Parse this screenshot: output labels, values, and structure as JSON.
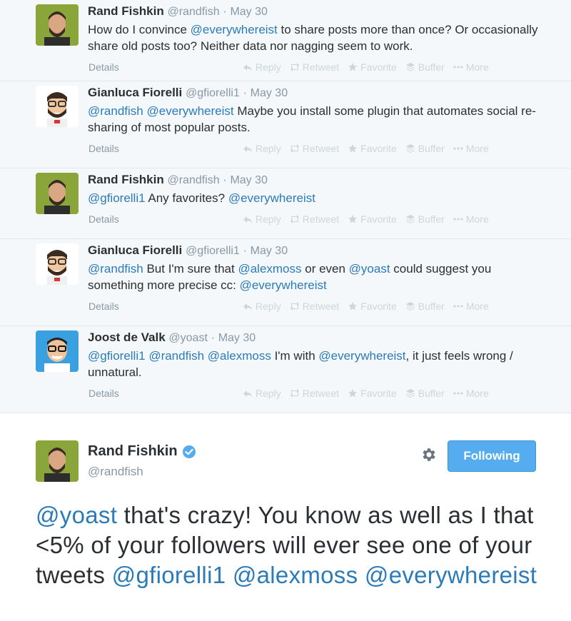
{
  "replies": [
    {
      "fullname": "Rand Fishkin",
      "screenname": "@randfish",
      "sep": "·",
      "date": "May 30",
      "avatar": "rand-avatar",
      "text_parts": [
        {
          "t": "How do I convince ",
          "m": false
        },
        {
          "t": "@everywhereist",
          "m": true
        },
        {
          "t": " to share posts more than once? Or occasionally share old posts too? Neither data nor nagging seem to work.",
          "m": false
        }
      ]
    },
    {
      "fullname": "Gianluca Fiorelli",
      "screenname": "@gfiorelli1",
      "sep": "·",
      "date": "May 30",
      "avatar": "gianluca-avatar",
      "text_parts": [
        {
          "t": "@randfish",
          "m": true
        },
        {
          "t": " ",
          "m": false
        },
        {
          "t": "@everywhereist",
          "m": true
        },
        {
          "t": " Maybe you install some plugin that automates social re-sharing of most popular posts.",
          "m": false
        }
      ]
    },
    {
      "fullname": "Rand Fishkin",
      "screenname": "@randfish",
      "sep": "·",
      "date": "May 30",
      "avatar": "rand-avatar",
      "text_parts": [
        {
          "t": "@gfiorelli1",
          "m": true
        },
        {
          "t": " Any favorites? ",
          "m": false
        },
        {
          "t": "@everywhereist",
          "m": true
        }
      ]
    },
    {
      "fullname": "Gianluca Fiorelli",
      "screenname": "@gfiorelli1",
      "sep": "·",
      "date": "May 30",
      "avatar": "gianluca-avatar",
      "text_parts": [
        {
          "t": "@randfish",
          "m": true
        },
        {
          "t": " But I'm sure that ",
          "m": false
        },
        {
          "t": "@alexmoss",
          "m": true
        },
        {
          "t": " or even ",
          "m": false
        },
        {
          "t": "@yoast",
          "m": true
        },
        {
          "t": " could suggest you something more precise cc: ",
          "m": false
        },
        {
          "t": "@everywhereist",
          "m": true
        }
      ]
    },
    {
      "fullname": "Joost de Valk",
      "screenname": "@yoast",
      "sep": "·",
      "date": "May 30",
      "avatar": "joost-avatar",
      "text_parts": [
        {
          "t": "@gfiorelli1",
          "m": true
        },
        {
          "t": " ",
          "m": false
        },
        {
          "t": "@randfish",
          "m": true
        },
        {
          "t": " ",
          "m": false
        },
        {
          "t": "@alexmoss",
          "m": true
        },
        {
          "t": " I'm with ",
          "m": false
        },
        {
          "t": "@everywhereist",
          "m": true
        },
        {
          "t": ", it just feels wrong / unnatural.",
          "m": false
        }
      ]
    }
  ],
  "actions": {
    "details": "Details",
    "reply": "Reply",
    "retweet": "Retweet",
    "favorite": "Favorite",
    "buffer": "Buffer",
    "more": "More"
  },
  "main_tweet": {
    "fullname": "Rand Fishkin",
    "screenname": "@randfish",
    "verified_icon": "verified-badge-icon",
    "follow_label": "Following",
    "text_parts": [
      {
        "t": "@yoast",
        "m": true
      },
      {
        "t": " that's crazy! You know as well as I that <5% of your followers will ever see one of your tweets ",
        "m": false
      },
      {
        "t": "@gfiorelli1",
        "m": true
      },
      {
        "t": " ",
        "m": false
      },
      {
        "t": "@alexmoss",
        "m": true
      },
      {
        "t": " ",
        "m": false
      },
      {
        "t": "@everywhereist",
        "m": true
      }
    ]
  },
  "colors": {
    "link": "#2b7bb9",
    "follow_button": "#55acee",
    "muted": "#8899a6"
  }
}
